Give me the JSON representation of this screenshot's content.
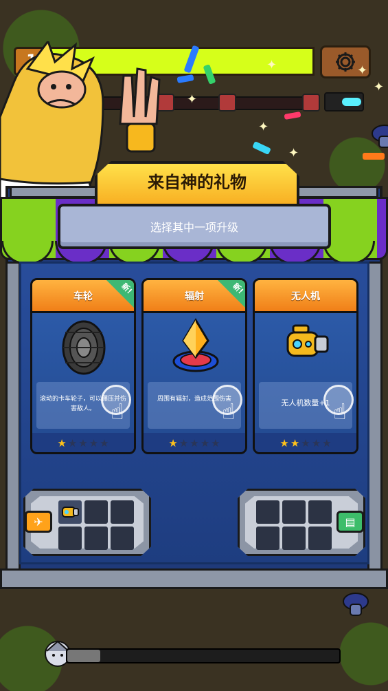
{
  "hud": {
    "level": "1",
    "xp_fill_fraction": 1.0,
    "settings_icon": "gear-icon"
  },
  "dialog": {
    "title": "来自神的礼物",
    "subtitle": "选择其中一项升级",
    "new_tag": "新!"
  },
  "cards": [
    {
      "name": "车轮",
      "desc": "滚动的卡车轮子，可以碾压并伤害敌人。",
      "is_new": true,
      "stars": 1,
      "max_stars": 5,
      "icon": "tire-icon"
    },
    {
      "name": "辐射",
      "desc": "周围有辐射，造成范围伤害",
      "is_new": true,
      "stars": 1,
      "max_stars": 5,
      "icon": "radiation-crystal-icon"
    },
    {
      "name": "无人机",
      "desc": "无人机数量+1",
      "is_new": false,
      "stars": 2,
      "max_stars": 5,
      "icon": "drone-icon"
    }
  ],
  "inventory": {
    "weapons_slots": 6,
    "weapons_filled": 1,
    "items_slots": 6,
    "items_filled": 0
  },
  "bottom_progress_fraction": 0.12,
  "colors": {
    "xp": "#d6ff1a",
    "awning_green": "#86d21f",
    "awning_purple": "#6a2ec7",
    "card_header": "#f07f18",
    "new_tag": "#3db874",
    "star_on": "#ffc21a"
  }
}
